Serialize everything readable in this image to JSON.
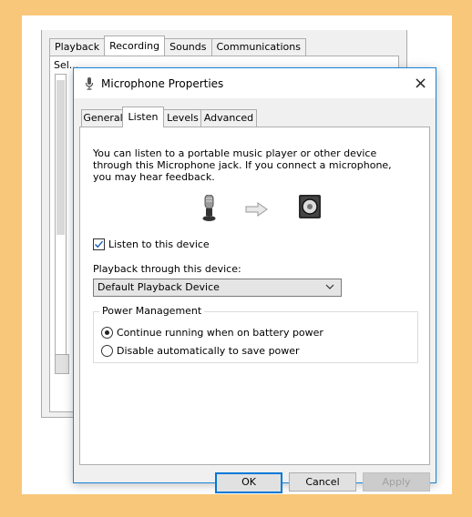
{
  "background_window": {
    "tabs": [
      "Playback",
      "Recording",
      "Sounds",
      "Communications"
    ],
    "active_tab": "Recording",
    "partial_text": "Sel..."
  },
  "dialog": {
    "title": "Microphone Properties",
    "close_label": "×",
    "tabs": [
      {
        "label": "General"
      },
      {
        "label": "Listen"
      },
      {
        "label": "Levels"
      },
      {
        "label": "Advanced"
      }
    ],
    "active_tab": "Listen",
    "description": "You can listen to a portable music player or other device through this Microphone jack.  If you connect a microphone, you may hear feedback.",
    "listen_checkbox": {
      "label": "Listen to this device",
      "checked": true
    },
    "playback_label": "Playback through this device:",
    "playback_device": "Default Playback Device",
    "power_management": {
      "title": "Power Management",
      "options": [
        {
          "label": "Continue running when on battery power",
          "selected": true
        },
        {
          "label": "Disable automatically to save power",
          "selected": false
        }
      ]
    },
    "buttons": {
      "ok": "OK",
      "cancel": "Cancel",
      "apply": "Apply"
    }
  },
  "colors": {
    "page_background": "#f9c77a",
    "accent": "#0078d7"
  }
}
